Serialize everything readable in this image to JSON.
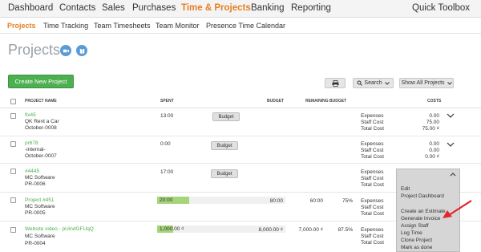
{
  "topnav": {
    "items": [
      "Dashboard",
      "Contacts",
      "Sales",
      "Purchases",
      "Time & Projects",
      "Banking",
      "Reporting"
    ],
    "active_index": 4,
    "quick_toolbox": "Quick Toolbox"
  },
  "subnav": {
    "items": [
      "Projects",
      "Time Tracking",
      "Team Timesheets",
      "Team Monitor",
      "Presence Time Calendar"
    ],
    "active_index": 0
  },
  "page": {
    "title": "Projects",
    "icons": [
      "video-icon",
      "book-icon"
    ]
  },
  "toolbar": {
    "create_label": "Create New Project",
    "print_icon": "print-icon",
    "search_label": "Search",
    "filter_label": "Show All Projects"
  },
  "table": {
    "headers": {
      "project_name": "PROJECT NAME",
      "spent": "SPENT",
      "budget": "BUDGET",
      "remaining": "REMAINING BUDGET",
      "costs": "COSTS"
    },
    "rows": [
      {
        "name": "fix45",
        "client": "QK Rent a Car",
        "code": "October-0008",
        "spent": "13:00",
        "budget_button": "Budget",
        "cost_labels": [
          "Expenses",
          "Staff Cost",
          "Total Cost"
        ],
        "cost_values": [
          "0.00",
          "75.00",
          "75.00 ₫"
        ]
      },
      {
        "name": "pr678",
        "client": "-internal-",
        "code": "October-0007",
        "spent": "0:00",
        "budget_button": "Budget",
        "cost_labels": [
          "Expenses",
          "Staff Cost",
          "Total Cost"
        ],
        "cost_values": [
          "0.00",
          "0.00",
          "0.00 ₫"
        ]
      },
      {
        "name": "#4445",
        "client": "MC Software",
        "code": "PR-0006",
        "spent": "17:00",
        "budget_button": "Budget",
        "cost_labels": [
          "Expenses",
          "Staff Cost",
          "Total Cost"
        ],
        "cost_values": [
          "",
          "",
          ""
        ]
      },
      {
        "name": "Project #451",
        "client": "MC Software",
        "code": "PR-0005",
        "spent": "20:00",
        "budget": "80:00",
        "remaining": "60:00",
        "remaining_pct": "75%",
        "spent_fraction": 0.25,
        "cost_labels": [
          "Expenses",
          "Staff Cost",
          "Total Cost"
        ],
        "cost_values": [
          "",
          "",
          ""
        ]
      },
      {
        "name": "Website video - pUindGFUqQ",
        "client": "MC Software",
        "code": "PR-0004",
        "spent": "1,000.00 ₫",
        "budget": "8,000.00 ₫",
        "remaining": "7,000.00 ₫",
        "remaining_pct": "87.5%",
        "spent_fraction": 0.125,
        "cost_labels": [
          "Expenses",
          "Staff Cost",
          "Total Cost"
        ],
        "cost_values": [
          "",
          "",
          ""
        ]
      }
    ]
  },
  "menu": {
    "items": [
      "Edit",
      "Project Dashboard",
      "Create an Estimate",
      "Generate Invoice",
      "Assign Staff",
      "Log Time",
      "Clone Project",
      "Mark as done"
    ]
  },
  "colors": {
    "accent": "#e67e22",
    "green": "#4caf50",
    "progress": "#a5d47a",
    "arrow": "#e3262b"
  }
}
